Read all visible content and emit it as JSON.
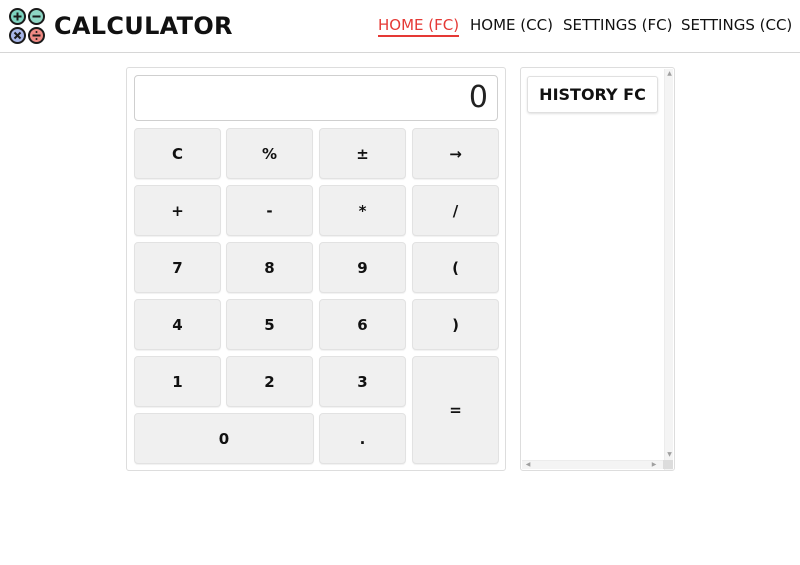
{
  "header": {
    "brand": "CALCULATOR",
    "logo_icons": [
      "plus-circle-icon",
      "minus-circle-icon",
      "times-circle-icon",
      "divide-circle-icon"
    ],
    "colors": {
      "plus": "#3a9a8c",
      "minus": "#3a9a8c",
      "times": "#5a6fb0",
      "divide": "#e0605a",
      "active_nav": "#e53935"
    },
    "nav": [
      {
        "label": "HOME (FC)",
        "active": true
      },
      {
        "label": "HOME (CC)",
        "active": false
      },
      {
        "label": "SETTINGS (FC)",
        "active": false
      },
      {
        "label": "SETTINGS (CC)",
        "active": false
      }
    ]
  },
  "calculator": {
    "display": "0",
    "keys": {
      "clear": "C",
      "percent": "%",
      "plus_minus": "±",
      "backspace": "→",
      "add": "+",
      "subtract": "-",
      "multiply": "*",
      "divide": "/",
      "seven": "7",
      "eight": "8",
      "nine": "9",
      "open_paren": "(",
      "four": "4",
      "five": "5",
      "six": "6",
      "close_paren": ")",
      "one": "1",
      "two": "2",
      "three": "3",
      "equals": "=",
      "zero": "0",
      "decimal": "."
    }
  },
  "history": {
    "title": "HISTORY FC"
  }
}
